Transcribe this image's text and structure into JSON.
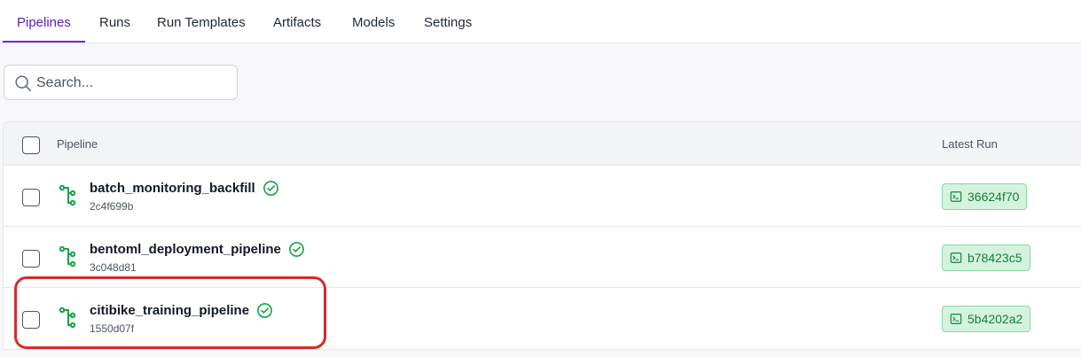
{
  "tabs": [
    {
      "label": "Pipelines",
      "active": true
    },
    {
      "label": "Runs",
      "active": false
    },
    {
      "label": "Run Templates",
      "active": false
    },
    {
      "label": "Artifacts",
      "active": false
    },
    {
      "label": "Models",
      "active": false
    },
    {
      "label": "Settings",
      "active": false
    }
  ],
  "search": {
    "placeholder": "Search...",
    "value": ""
  },
  "table": {
    "columns": {
      "pipeline": "Pipeline",
      "latest_run": "Latest Run"
    },
    "rows": [
      {
        "name": "batch_monitoring_backfill",
        "id": "2c4f699b",
        "latest_run": "36624f70",
        "status": "completed",
        "checked": false
      },
      {
        "name": "bentoml_deployment_pipeline",
        "id": "3c048d81",
        "latest_run": "b78423c5",
        "status": "completed",
        "checked": false
      },
      {
        "name": "citibike_training_pipeline",
        "id": "1550d07f",
        "latest_run": "5b4202a2",
        "status": "completed",
        "checked": false
      }
    ]
  },
  "icons": {
    "search": "search-icon",
    "pipeline": "pipeline-tree-icon",
    "status": "check-circle-icon",
    "run": "terminal-icon"
  },
  "colors": {
    "accent": "#6d28d9",
    "success": "#16a34a",
    "badge_bg": "#d4f3dd",
    "highlight": "#d62a2a"
  }
}
